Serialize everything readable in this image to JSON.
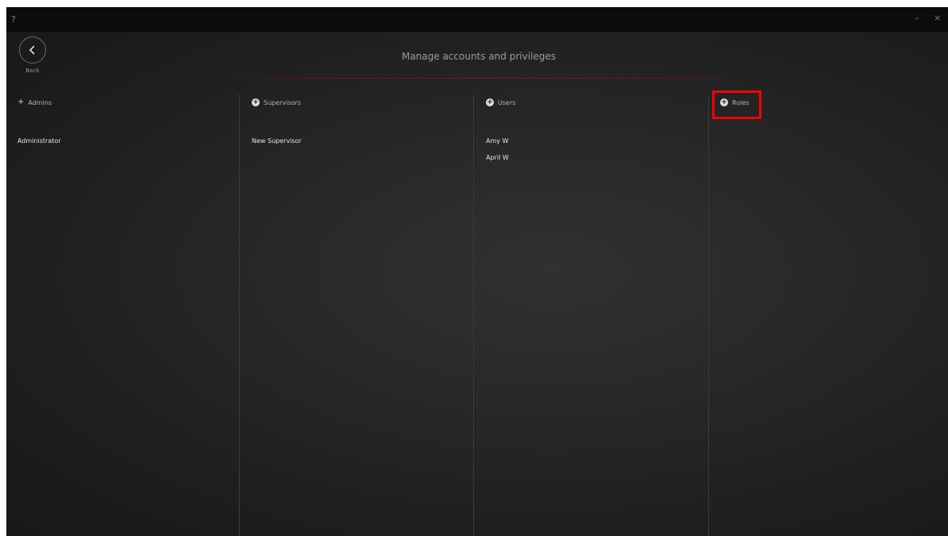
{
  "titlebar": {
    "help": "?",
    "minimize": "–",
    "close": "×"
  },
  "header": {
    "back_label": "Back",
    "title": "Manage accounts and privileges",
    "back_icon": "chevron-left-icon"
  },
  "columns": [
    {
      "header": "Admins",
      "add_icon": "plus-icon",
      "items": [
        "Administrator"
      ]
    },
    {
      "header": "Supervisors",
      "add_icon": "plus-circle-icon",
      "items": [
        "New Supervisor"
      ]
    },
    {
      "header": "Users",
      "add_icon": "plus-circle-icon",
      "items": [
        "Amy W",
        "April W"
      ]
    },
    {
      "header": "Roles",
      "add_icon": "plus-circle-icon",
      "items": []
    }
  ],
  "colors": {
    "accent_line": "#8c1010",
    "highlight": "#ff0000"
  }
}
